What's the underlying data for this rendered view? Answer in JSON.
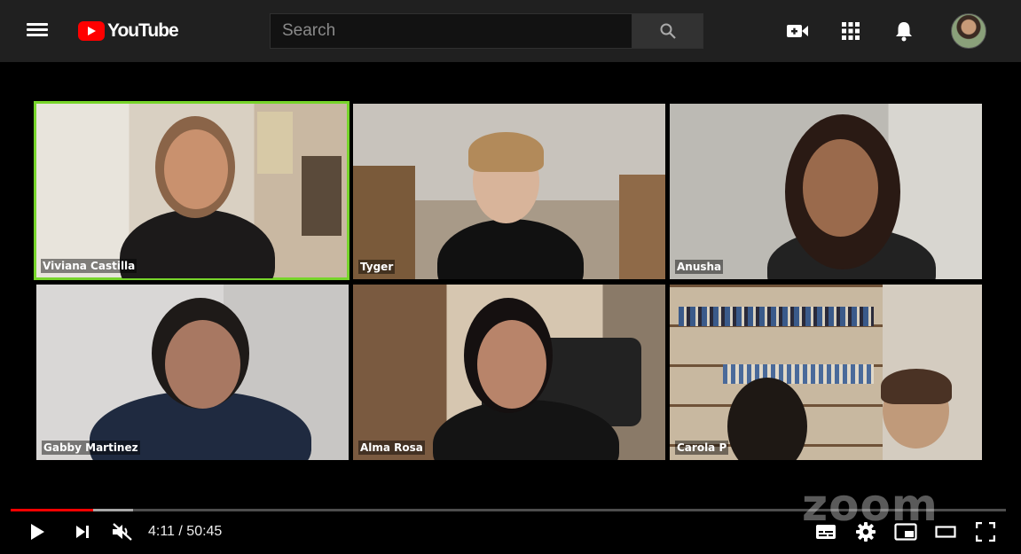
{
  "header": {
    "logo_text": "YouTube",
    "search_placeholder": "Search",
    "icons": [
      "menu-icon",
      "youtube-logo-icon",
      "search-icon",
      "create-video-icon",
      "apps-icon",
      "notifications-icon",
      "avatar"
    ]
  },
  "video": {
    "participants": [
      {
        "name": "Viviana Castilla",
        "active": true
      },
      {
        "name": "Tyger",
        "active": false
      },
      {
        "name": "Anusha",
        "active": false
      },
      {
        "name": "Gabby Martinez",
        "active": false
      },
      {
        "name": "Alma Rosa",
        "active": false
      },
      {
        "name": "Carola P",
        "active": false
      }
    ],
    "watermark": "zoom",
    "active_border_color": "#77d42a"
  },
  "player": {
    "time": "4:11 / 50:45",
    "progress_fraction": 0.0826,
    "buffered_fraction": 0.123,
    "progress_color": "#ff0000",
    "controls": [
      "play-icon",
      "next-icon",
      "muted-volume-icon",
      "subtitles-icon",
      "settings-icon",
      "miniplayer-icon",
      "theater-mode-icon",
      "fullscreen-icon"
    ]
  }
}
